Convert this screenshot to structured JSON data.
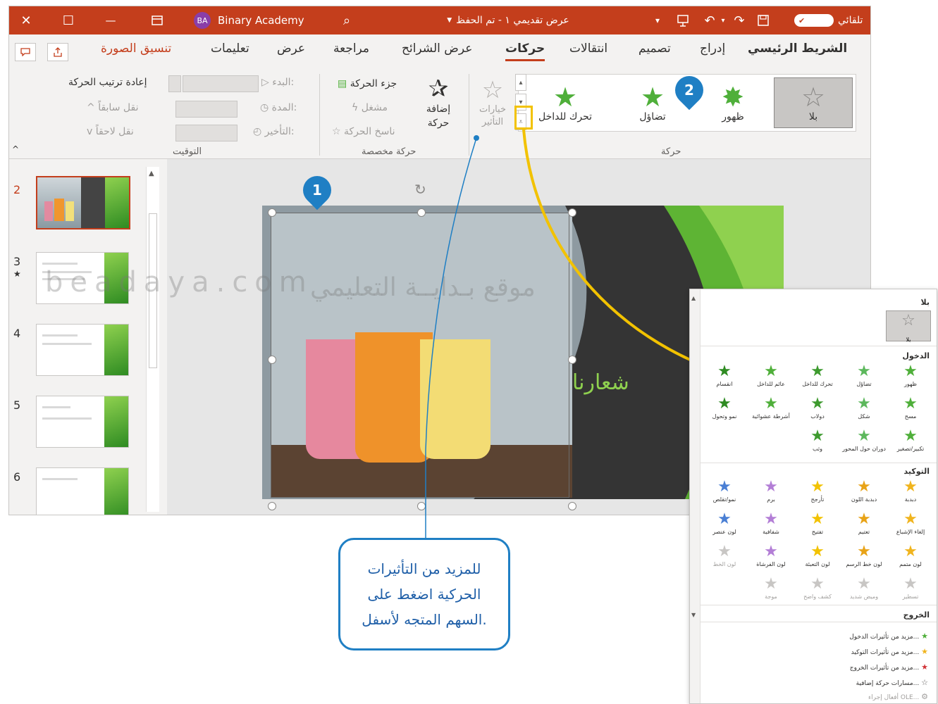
{
  "titlebar": {
    "close_glyph": "✕",
    "restore_glyph": "☐",
    "minimize_glyph": "—",
    "account_initials": "BA",
    "account_name": "Binary Academy",
    "search_glyph": "⌕",
    "doc_title": "عرض تقديمي ١ - تم الحفظ",
    "autosave_label": "تلقائي",
    "autosave_state": "✔"
  },
  "tabs": [
    "الشريط الرئيسي",
    "إدراج",
    "تصميم",
    "انتقالات",
    "حركات",
    "عرض الشرائح",
    "مراجعة",
    "عرض",
    "تعليمات",
    "تنسيق الصورة"
  ],
  "ribbon": {
    "animation_group": {
      "label": "حركة",
      "items": [
        {
          "label": "بلا",
          "icon": "star-outline-icon"
        },
        {
          "label": "ظهور",
          "icon": "star-burst-green-icon"
        },
        {
          "label": "تضاؤل",
          "icon": "star-fade-green-icon"
        },
        {
          "label": "تحرك للداخل",
          "icon": "star-fly-in-green-icon"
        }
      ],
      "effect_options": "خيارات التأثير"
    },
    "advanced_group": {
      "label": "حركة مخصصة",
      "add_animation": "إضافة حركة",
      "animation_pane": "جزء الحركة",
      "trigger": "مشغل",
      "painter": "ناسخ الحركة"
    },
    "timing_group": {
      "label": "التوقيت",
      "start": "البدء:",
      "duration": "المدة:",
      "delay": "التأخير:",
      "reorder": "إعادة ترتيب الحركة",
      "move_earlier": "نقل سابقاً",
      "move_later": "نقل لاحقاً"
    }
  },
  "thumbs": [
    "2",
    "3",
    "4",
    "5",
    "6"
  ],
  "thumb3_star": "★",
  "slide": {
    "title": "شعارنا"
  },
  "markers": {
    "one": "1",
    "two": "2"
  },
  "callout": "للمزيد من التأثيرات الحركية اضغط على السهم المتجه لأسفل.",
  "watermark": {
    "arabic_site": "موقع بـدايــة التعليمي",
    "latin_site": "beadaya.com"
  },
  "gallery_overlay": {
    "none_header": "بلا",
    "none_item": "بلا",
    "entrance_header": "الدخول",
    "entrance": [
      "ظهور",
      "تضاؤل",
      "تحرك للداخل",
      "عائم للداخل",
      "انقسام",
      "مسح",
      "شكل",
      "دولاب",
      "أشرطة عشوائية",
      "نمو وتحول",
      "تكبير/تصغير",
      "دوران حول المحور",
      "وثب"
    ],
    "emphasis_header": "التوكيد",
    "emphasis": [
      "دبدبة",
      "دبدبة اللون",
      "تأرجح",
      "برم",
      "نمو/تقلص",
      "إلغاء الإشباع",
      "تعتيم",
      "تفتيح",
      "شفافية",
      "لون عنصر",
      "لون متمم",
      "لون خط الرسم",
      "لون التعبئة",
      "لون الفرشاة",
      "لون الخط",
      "تسطير",
      "وميض شديد",
      "كشف واضح",
      "موجة"
    ],
    "exit_header": "الخروج",
    "links": [
      "مزيد من تأثيرات الدخول...",
      "مزيد من تأثيرات التوكيد...",
      "مزيد من تأثيرات الخروج...",
      "مسارات حركة إضافية...",
      "أفعال إجراء OLE..."
    ]
  },
  "colors": {
    "accent": "#c43e1c",
    "highlight": "#f2c200",
    "callout": "#1f7fc4",
    "star_green": "#4faf3a"
  }
}
